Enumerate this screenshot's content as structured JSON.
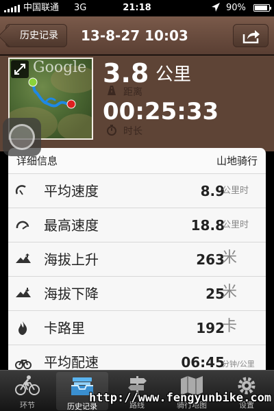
{
  "status_bar": {
    "carrier": "中国联通",
    "network": "3G",
    "time": "21:18",
    "battery": "90%"
  },
  "nav": {
    "back_label": "历史记录",
    "title": "13-8-27 10:03"
  },
  "summary": {
    "map_logo": "Google",
    "distance_value": "3.8",
    "distance_unit": "公里",
    "distance_caption": "距离",
    "duration_value": "00:25:33",
    "duration_caption": "时长"
  },
  "details": {
    "header_label": "详细信息",
    "activity_type": "山地骑行",
    "rows": [
      {
        "icon": "speedometer-icon",
        "label": "平均速度",
        "value": "8.9",
        "unit": "公里时"
      },
      {
        "icon": "speedometer-max-icon",
        "label": "最高速度",
        "value": "18.8",
        "unit": "公里时"
      },
      {
        "icon": "mountain-up-icon",
        "label": "海拔上升",
        "value": "263",
        "unit": "米"
      },
      {
        "icon": "mountain-down-icon",
        "label": "海拔下降",
        "value": "25",
        "unit": "米"
      },
      {
        "icon": "flame-icon",
        "label": "卡路里",
        "value": "192",
        "unit": "卡"
      },
      {
        "icon": "pace-icon",
        "label": "平均配速",
        "value": "06:45",
        "unit": "分钟/公里"
      }
    ]
  },
  "tabs": [
    {
      "icon": "bicycle-icon",
      "label": "环节"
    },
    {
      "icon": "history-tray-icon",
      "label": "历史记录",
      "active": true
    },
    {
      "icon": "signpost-icon",
      "label": "路线"
    },
    {
      "icon": "map-fold-icon",
      "label": "骑行地图"
    },
    {
      "icon": "gear-icon",
      "label": "设置"
    }
  ],
  "watermark": "http://www.fengyunbike.com",
  "colors": {
    "nav_brown": "#6a4c3e",
    "panel_brown": "#5e4436",
    "route_blue": "#1e88e5",
    "start_green": "#8bd33a",
    "end_red": "#e02020"
  }
}
